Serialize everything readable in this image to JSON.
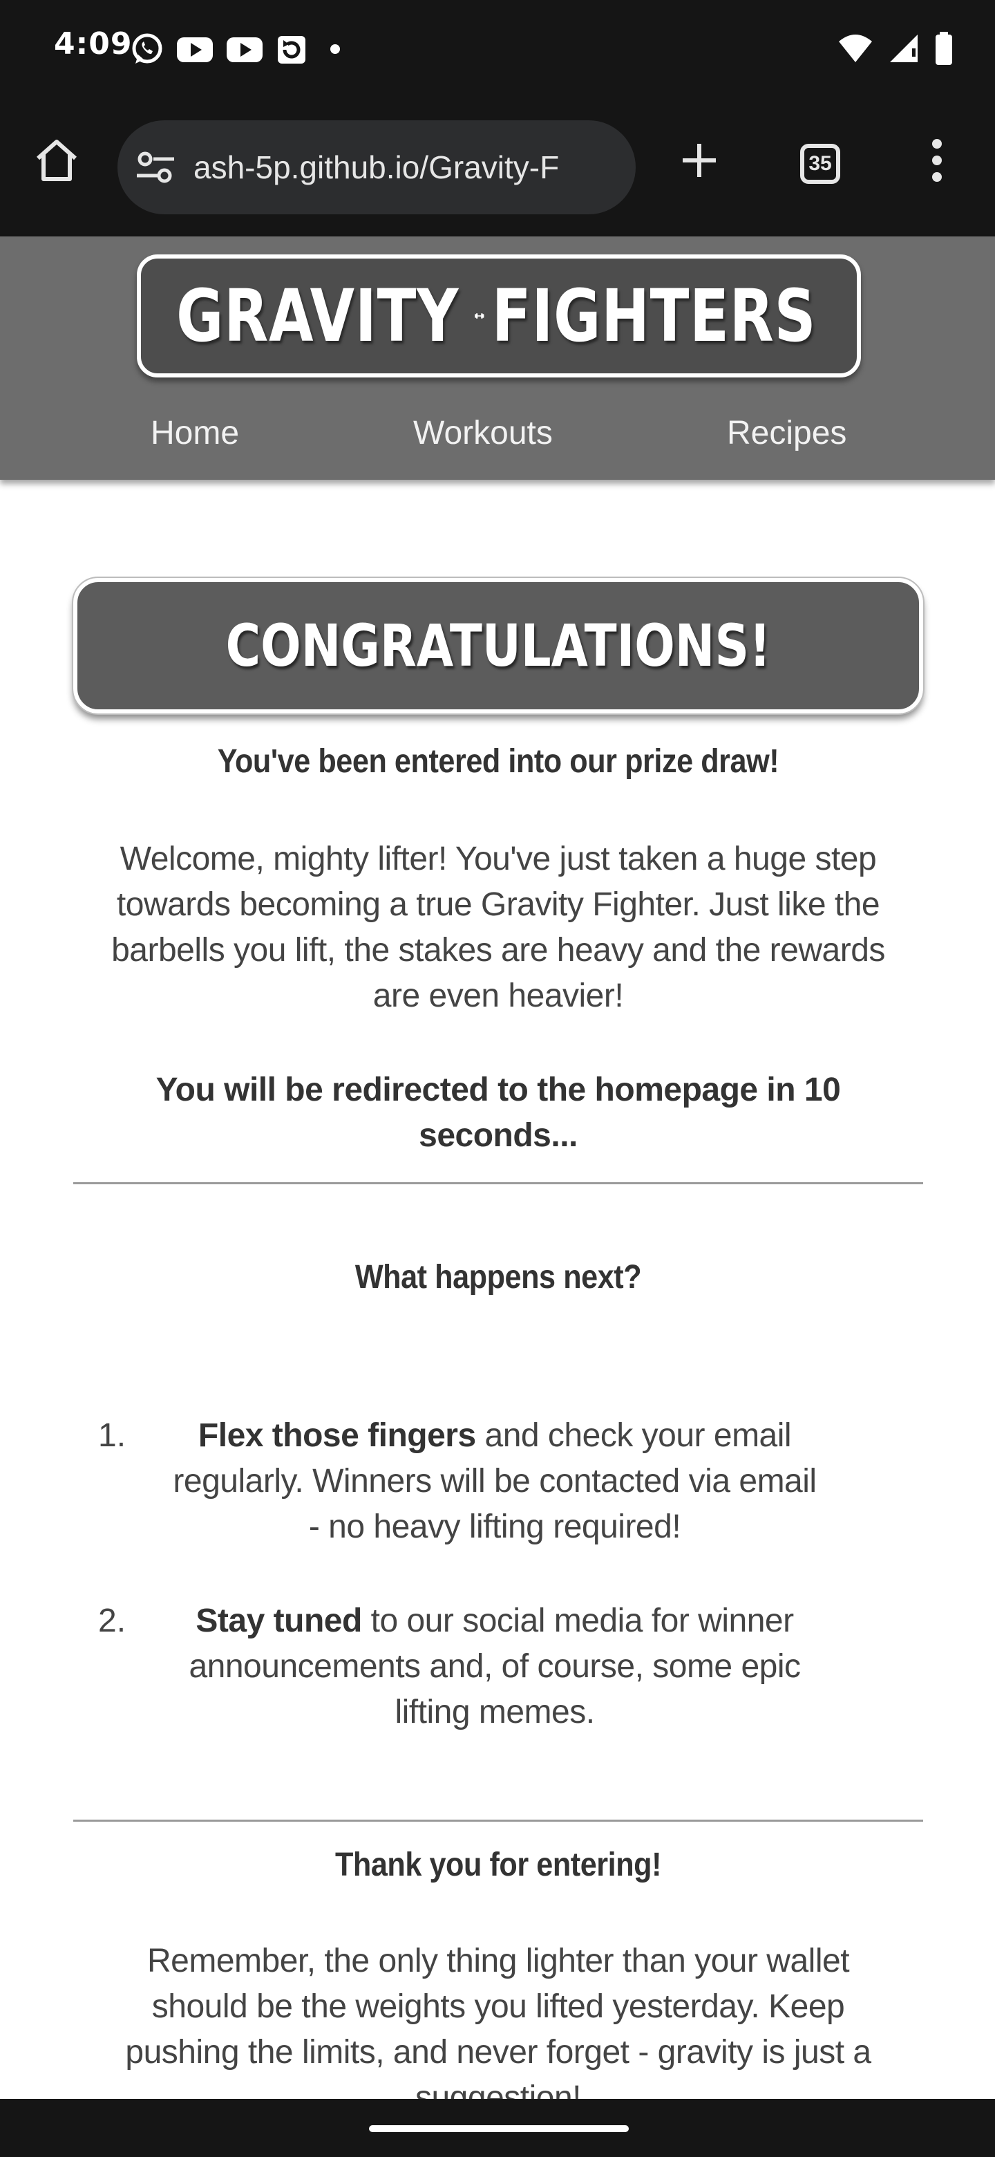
{
  "status_bar": {
    "time": "4:09",
    "notification_icons": [
      "whatsapp-icon",
      "youtube-icon",
      "youtube-icon",
      "screen-rotate-icon",
      "notification-dot"
    ],
    "system_icons": [
      "wifi-icon",
      "signal-icon",
      "battery-icon"
    ]
  },
  "browser": {
    "url": "ash-5p.github.io/Gravity-F",
    "tab_count": "35",
    "icons": [
      "home-icon",
      "site-settings-icon",
      "plus-icon",
      "tab-switcher-icon",
      "more-vert-icon"
    ]
  },
  "site": {
    "logo_left": "GRAVITY",
    "logo_right": "FIGHTERS",
    "logo_icon": "dumbbell-icon",
    "nav": [
      "Home",
      "Workouts",
      "Recipes"
    ]
  },
  "main": {
    "banner": "CONGRATULATIONS!",
    "subhead": "You've been entered into our prize draw!",
    "welcome_lines": [
      "Welcome, mighty lifter! You've just taken a huge step",
      "towards becoming a true Gravity Fighter. Just like the",
      "barbells you lift, the stakes are heavy and the rewards",
      "are even heavier!"
    ],
    "redirect_lines": [
      "You will be redirected to the homepage in 10",
      "seconds..."
    ],
    "next_heading": "What happens next?",
    "steps": [
      {
        "number": "1.",
        "bold": "Flex those fingers",
        "lines": [
          " and check your email",
          "regularly. Winners will be contacted via email",
          "- no heavy lifting required!"
        ]
      },
      {
        "number": "2.",
        "bold": "Stay tuned",
        "lines": [
          " to our social media for winner",
          "announcements and, of course, some epic",
          "lifting memes."
        ]
      }
    ],
    "thanks_heading": "Thank you for entering!",
    "closing_lines": [
      "Remember, the only thing lighter than your wallet",
      "should be the weights you lifted yesterday. Keep",
      "pushing the limits, and never forget - gravity is just a",
      "suggestion!"
    ]
  },
  "colors": {
    "browser_chrome": "#151515",
    "header_bg": "#6d6d6d",
    "banner_bg": "#5c5c5c",
    "text": "#444444"
  }
}
